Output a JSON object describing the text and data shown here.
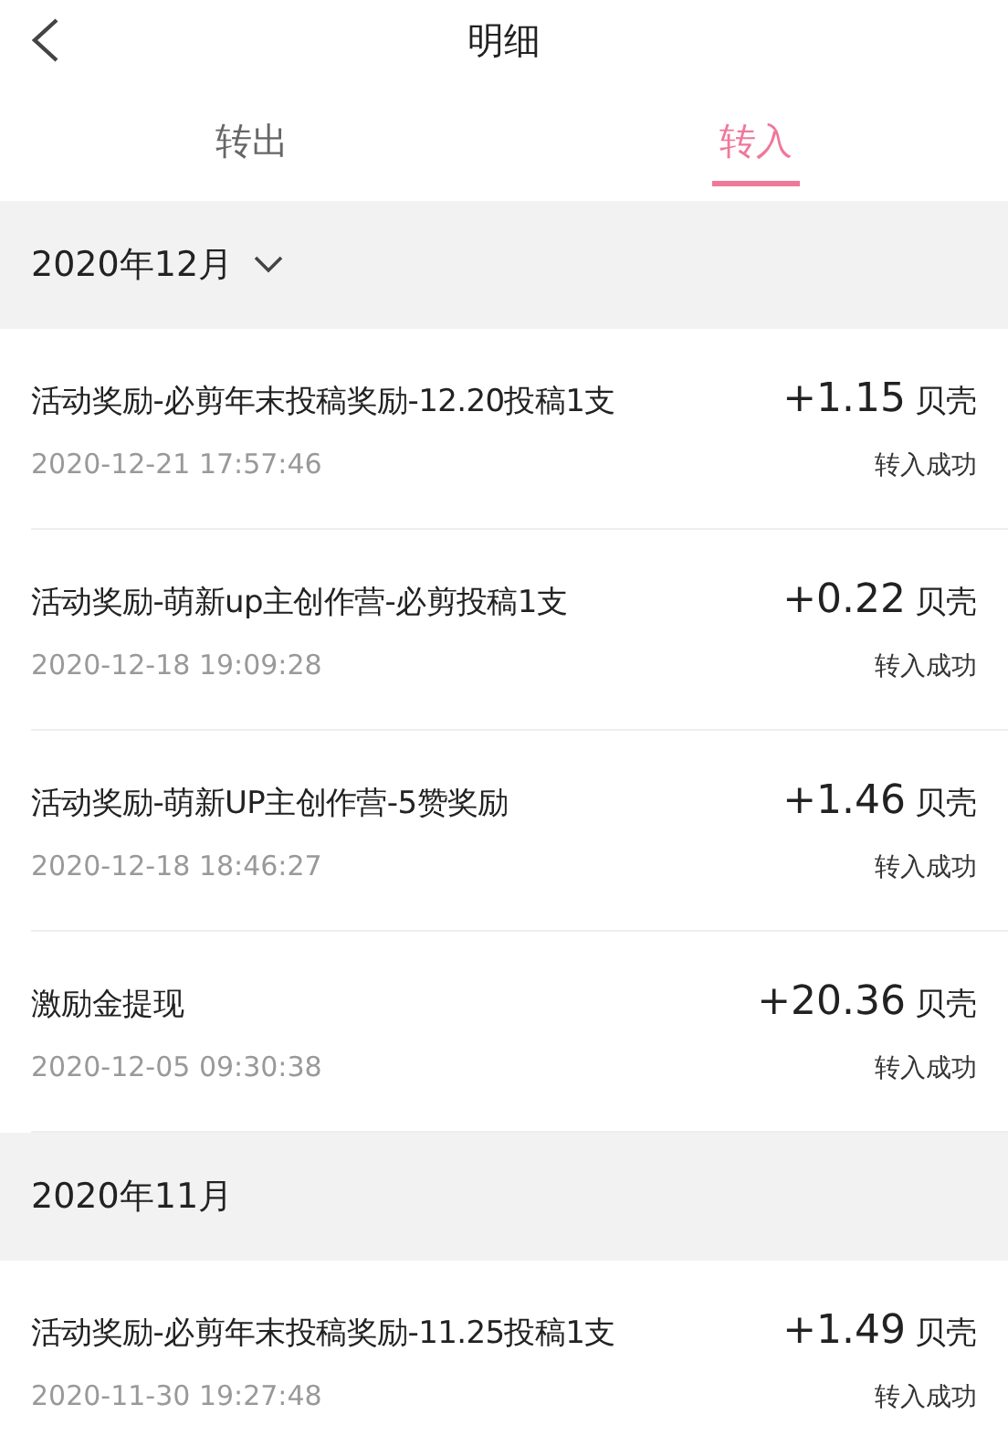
{
  "header": {
    "title": "明细"
  },
  "tabs": [
    {
      "label": "转出",
      "selected": false
    },
    {
      "label": "转入",
      "selected": true
    }
  ],
  "sections": [
    {
      "month": "2020年12月",
      "dropdown": true,
      "rows": [
        {
          "title": "活动奖励-必剪年末投稿奖励-12.20投稿1支",
          "amount": "+1.15",
          "unit": "贝壳",
          "time": "2020-12-21 17:57:46",
          "status": "转入成功"
        },
        {
          "title": "活动奖励-萌新up主创作营-必剪投稿1支",
          "amount": "+0.22",
          "unit": "贝壳",
          "time": "2020-12-18 19:09:28",
          "status": "转入成功"
        },
        {
          "title": "活动奖励-萌新UP主创作营-5赞奖励",
          "amount": "+1.46",
          "unit": "贝壳",
          "time": "2020-12-18 18:46:27",
          "status": "转入成功"
        },
        {
          "title": "激励金提现",
          "amount": "+20.36",
          "unit": "贝壳",
          "time": "2020-12-05 09:30:38",
          "status": "转入成功"
        }
      ]
    },
    {
      "month": "2020年11月",
      "dropdown": false,
      "rows": [
        {
          "title": "活动奖励-必剪年末投稿奖励-11.25投稿1支",
          "amount": "+1.49",
          "unit": "贝壳",
          "time": "2020-11-30 19:27:48",
          "status": "转入成功"
        }
      ]
    }
  ]
}
